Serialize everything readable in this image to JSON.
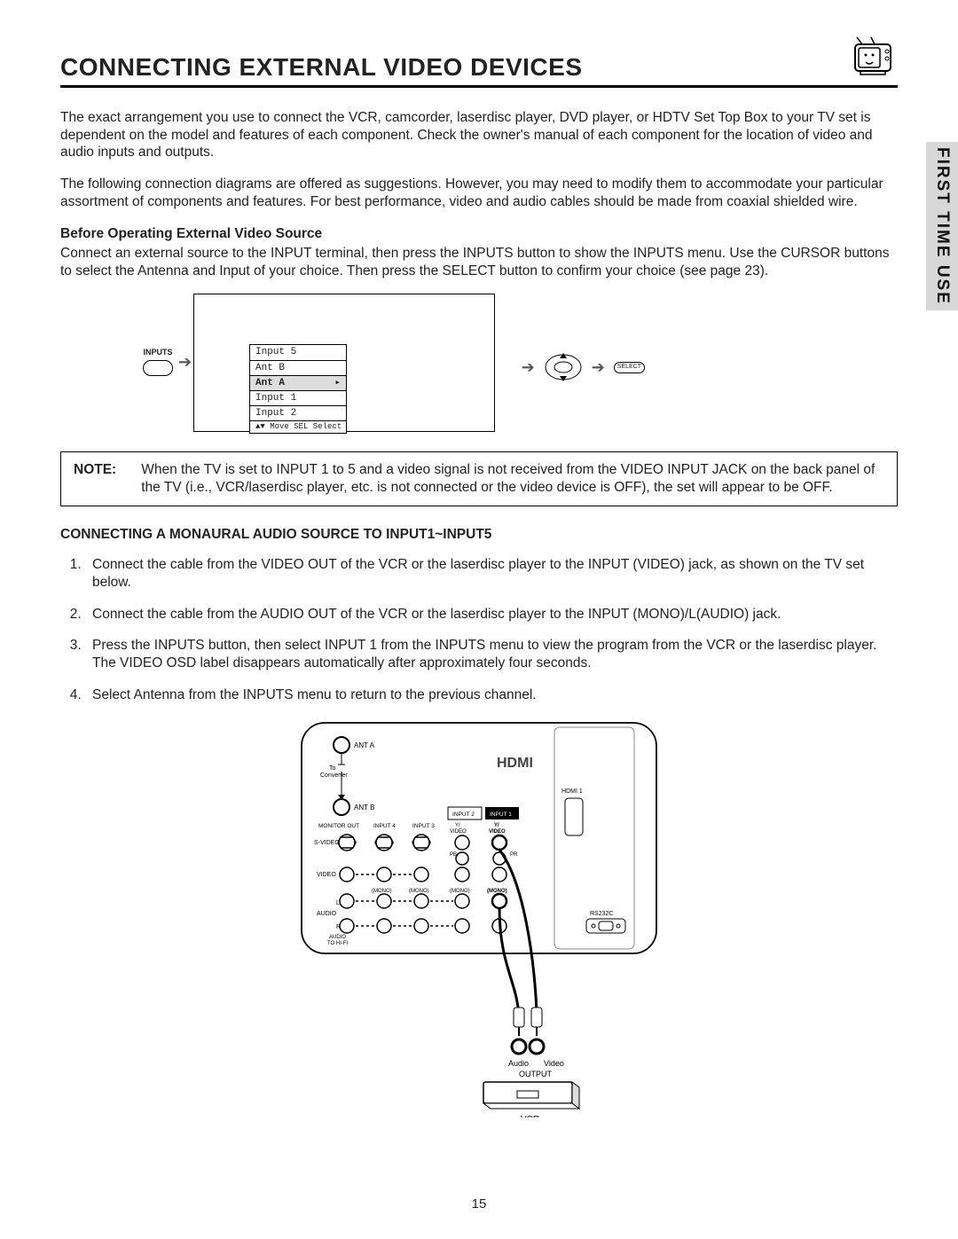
{
  "header": {
    "title": "CONNECTING EXTERNAL VIDEO DEVICES"
  },
  "side_tab": "FIRST TIME USE",
  "intro1": "The exact arrangement you use to connect the VCR, camcorder, laserdisc player, DVD player, or HDTV Set Top Box to your TV set is dependent on the model and features of each component.  Check the owner's manual of each component for the location of video and audio inputs and outputs.",
  "intro2": "The following connection diagrams are offered as suggestions.  However, you may need to modify them to accommodate your particular assortment of components and features.  For best performance, video and audio cables should be made from coaxial shielded wire.",
  "before_heading": "Before Operating External Video Source",
  "before_text": "Connect an external source to the INPUT terminal, then press the INPUTS button to show the INPUTS menu.  Use the CURSOR buttons to select the Antenna and Input of your choice.  Then press the SELECT button to confirm your choice (see page 23).",
  "inputs_menu": {
    "btn_label": "INPUTS",
    "items": [
      "Input 5",
      "Ant B",
      "Ant A",
      "Input 1",
      "Input 2"
    ],
    "footer": "▲▼ Move  SEL Select",
    "highlighted_index": 2,
    "select_label": "SELECT"
  },
  "note": {
    "label": "NOTE:",
    "text": "When the TV is set to INPUT 1 to 5 and a video signal is not received from the VIDEO INPUT JACK on the back panel of the TV (i.e., VCR/laserdisc player, etc. is not connected or the video device is OFF), the set will appear to be OFF."
  },
  "monaural_heading": "CONNECTING A MONAURAL AUDIO SOURCE TO INPUT1~INPUT5",
  "steps": [
    "Connect the cable from the VIDEO OUT of the VCR or the laserdisc player to the INPUT (VIDEO) jack, as shown on the TV set below.",
    "Connect the cable from the AUDIO OUT of the VCR or the laserdisc player to the INPUT (MONO)/L(AUDIO) jack.",
    "Press the INPUTS button, then select INPUT 1 from the INPUTS menu to view the program from the VCR or the laserdisc player. The VIDEO OSD label disappears automatically after approximately four seconds.",
    "Select Antenna from the INPUTS menu to return to the previous channel."
  ],
  "back_panel": {
    "hdmi_label": "HDMI",
    "hdmi1": "HDMI 1",
    "ant_a": "ANT A",
    "ant_b": "ANT B",
    "to_converter": "To Converter",
    "cols": [
      "MONITOR OUT",
      "INPUT 4",
      "INPUT 3",
      "INPUT 2",
      "INPUT 1"
    ],
    "row_svideo": "S-VIDEO",
    "row_video": "VIDEO",
    "y_label": "Y/VIDEO",
    "pb": "PB",
    "pr": "PR",
    "mono": "(MONO)",
    "audio_l": "L",
    "audio_r": "R",
    "audio_label": "AUDIO",
    "audio_to_hifi": "AUDIO TO HI-FI",
    "rs232c": "RS232C",
    "vcr_out_audio": "Audio",
    "vcr_out_video": "Video",
    "vcr_out_label": "OUTPUT",
    "vcr_label": "VCR"
  },
  "page_number": "15"
}
